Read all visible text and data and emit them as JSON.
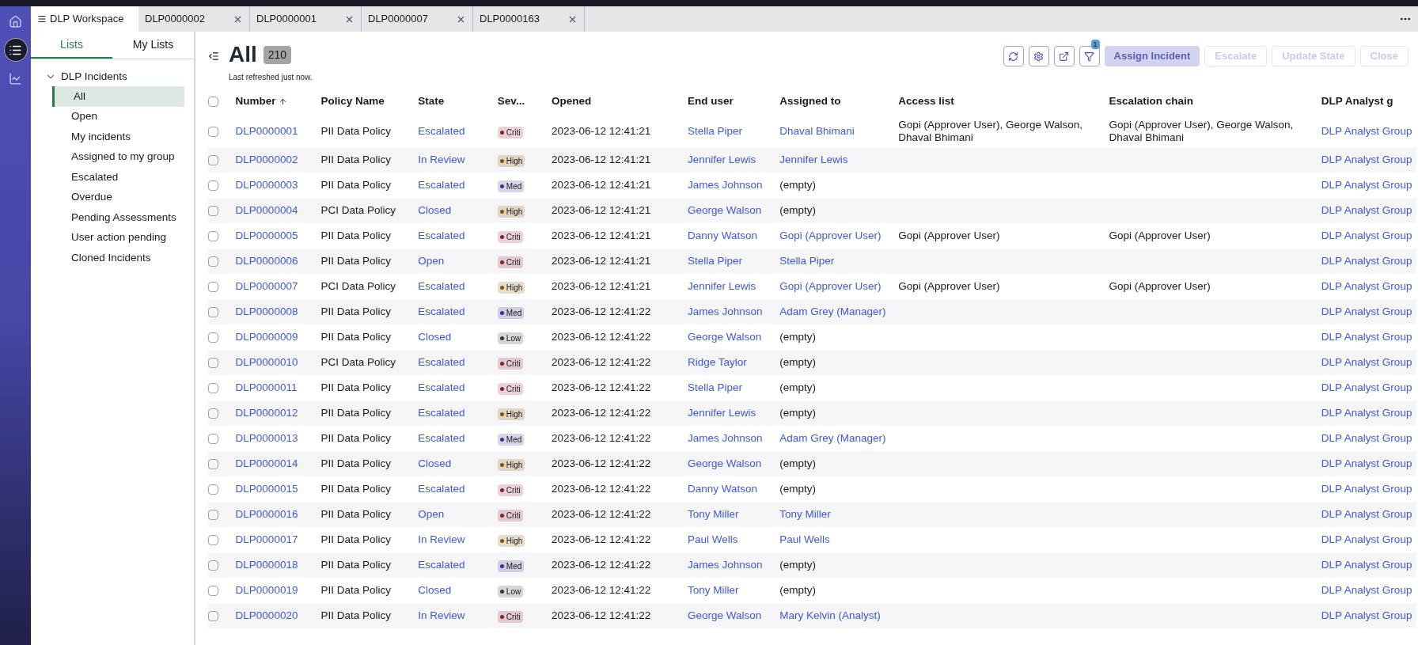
{
  "rail": [
    {
      "kind": "home",
      "selected": false
    },
    {
      "kind": "list",
      "selected": true
    },
    {
      "kind": "analytics",
      "selected": false
    }
  ],
  "tabs": [
    {
      "label": "DLP Workspace",
      "selected": true,
      "closable": false
    },
    {
      "label": "DLP0000002",
      "selected": false,
      "closable": true
    },
    {
      "label": "DLP0000001",
      "selected": false,
      "closable": true
    },
    {
      "label": "DLP0000007",
      "selected": false,
      "closable": true
    },
    {
      "label": "DLP0000163",
      "selected": false,
      "closable": true
    }
  ],
  "sidebar": {
    "tabs": [
      {
        "label": "Lists",
        "selected": true
      },
      {
        "label": "My Lists",
        "selected": false
      }
    ],
    "group": {
      "label": "DLP Incidents",
      "expanded": true,
      "children": [
        {
          "label": "All",
          "selected": true
        },
        {
          "label": "Open",
          "selected": false
        },
        {
          "label": "My incidents",
          "selected": false
        },
        {
          "label": "Assigned to my group",
          "selected": false
        },
        {
          "label": "Escalated",
          "selected": false
        },
        {
          "label": "Overdue",
          "selected": false
        },
        {
          "label": "Pending Assessments",
          "selected": false
        },
        {
          "label": "User action pending",
          "selected": false
        },
        {
          "label": "Cloned Incidents",
          "selected": false
        }
      ]
    }
  },
  "list": {
    "title": "All",
    "count": "210",
    "refreshed": "Last refreshed just now.",
    "filter_count": "1",
    "actions": [
      {
        "label": "Assign Incident",
        "kind": "primary",
        "disabled": true
      },
      {
        "label": "Escalate",
        "kind": "secondary",
        "disabled": true
      },
      {
        "label": "Update State",
        "kind": "secondary",
        "disabled": true
      },
      {
        "label": "Close",
        "kind": "secondary",
        "disabled": true
      }
    ]
  },
  "table": {
    "select_all_checked": false,
    "columns": [
      {
        "label": "Number",
        "sorted": true
      },
      {
        "label": "Policy Name",
        "sorted": false
      },
      {
        "label": "State",
        "sorted": false
      },
      {
        "label": "Sev...",
        "sorted": false
      },
      {
        "label": "Opened",
        "sorted": false
      },
      {
        "label": "End user",
        "sorted": false
      },
      {
        "label": "Assigned to",
        "sorted": false
      },
      {
        "label": "Access list",
        "sorted": false
      },
      {
        "label": "Escalation chain",
        "sorted": false
      },
      {
        "label": "DLP Analyst g",
        "sorted": false
      }
    ],
    "rows": [
      {
        "checked": false,
        "number": "DLP0000001",
        "policy": "PII Data Policy",
        "state": "Escalated",
        "severity": {
          "label": "Criti",
          "color": "#8b1e2b"
        },
        "opened": "2023-06-12 12:41:21",
        "end_user": "Stella Piper",
        "assigned_to": {
          "text": "Dhaval Bhimani",
          "kind": "link"
        },
        "access_list": "Gopi  (Approver User), George Walson, Dhaval Bhimani",
        "escalation_chain": "Gopi  (Approver User), George Walson, Dhaval Bhimani",
        "group": "DLP Analyst Group"
      },
      {
        "checked": false,
        "number": "DLP0000002",
        "policy": "PII Data Policy",
        "state": "In Review",
        "severity": {
          "label": "High",
          "color": "#8a5300"
        },
        "opened": "2023-06-12 12:41:21",
        "end_user": "Jennifer Lewis",
        "assigned_to": {
          "text": "Jennifer Lewis",
          "kind": "link"
        },
        "group": "DLP Analyst Group"
      },
      {
        "checked": false,
        "number": "DLP0000003",
        "policy": "PII Data Policy",
        "state": "Escalated",
        "severity": {
          "label": "Med",
          "color": "#3b2e8c"
        },
        "opened": "2023-06-12 12:41:21",
        "end_user": "James Johnson",
        "assigned_to": {
          "text": "(empty)",
          "kind": "plain"
        },
        "group": "DLP Analyst Group"
      },
      {
        "checked": false,
        "number": "DLP0000004",
        "policy": "PCI Data Policy",
        "state": "Closed",
        "severity": {
          "label": "High",
          "color": "#8a5300"
        },
        "opened": "2023-06-12 12:41:21",
        "end_user": "George Walson",
        "assigned_to": {
          "text": "(empty)",
          "kind": "plain"
        },
        "group": "DLP Analyst Group"
      },
      {
        "checked": false,
        "number": "DLP0000005",
        "policy": "PII Data Policy",
        "state": "Escalated",
        "severity": {
          "label": "Criti",
          "color": "#8b1e2b"
        },
        "opened": "2023-06-12 12:41:21",
        "end_user": "Danny Watson",
        "assigned_to": {
          "text": "Gopi  (Approver User)",
          "kind": "link"
        },
        "access_list": "Gopi  (Approver User)",
        "escalation_chain": "Gopi  (Approver User)",
        "group": "DLP Analyst Group"
      },
      {
        "checked": false,
        "number": "DLP0000006",
        "policy": "PII Data Policy",
        "state": "Open",
        "severity": {
          "label": "Criti",
          "color": "#8b1e2b"
        },
        "opened": "2023-06-12 12:41:21",
        "end_user": "Stella Piper",
        "assigned_to": {
          "text": "Stella Piper",
          "kind": "link"
        },
        "group": "DLP Analyst Group"
      },
      {
        "checked": false,
        "number": "DLP0000007",
        "policy": "PCI Data Policy",
        "state": "Escalated",
        "severity": {
          "label": "High",
          "color": "#8a5300"
        },
        "opened": "2023-06-12 12:41:21",
        "end_user": "Jennifer Lewis",
        "assigned_to": {
          "text": "Gopi  (Approver User)",
          "kind": "link"
        },
        "access_list": "Gopi  (Approver User)",
        "escalation_chain": "Gopi  (Approver User)",
        "group": "DLP Analyst Group"
      },
      {
        "checked": false,
        "number": "DLP0000008",
        "policy": "PII Data Policy",
        "state": "Escalated",
        "severity": {
          "label": "Med",
          "color": "#3b2e8c"
        },
        "opened": "2023-06-12 12:41:22",
        "end_user": "James Johnson",
        "assigned_to": {
          "text": "Adam Grey (Manager)",
          "kind": "link"
        },
        "group": "DLP Analyst Group"
      },
      {
        "checked": false,
        "number": "DLP0000009",
        "policy": "PII Data Policy",
        "state": "Closed",
        "severity": {
          "label": "Low",
          "color": "#333333"
        },
        "opened": "2023-06-12 12:41:22",
        "end_user": "George Walson",
        "assigned_to": {
          "text": "(empty)",
          "kind": "plain"
        },
        "group": "DLP Analyst Group"
      },
      {
        "checked": false,
        "number": "DLP0000010",
        "policy": "PCI Data Policy",
        "state": "Escalated",
        "severity": {
          "label": "Criti",
          "color": "#8b1e2b"
        },
        "opened": "2023-06-12 12:41:22",
        "end_user": "Ridge Taylor",
        "assigned_to": {
          "text": "(empty)",
          "kind": "plain"
        },
        "group": "DLP Analyst Group"
      },
      {
        "checked": false,
        "number": "DLP0000011",
        "policy": "PII Data Policy",
        "state": "Escalated",
        "severity": {
          "label": "Criti",
          "color": "#8b1e2b"
        },
        "opened": "2023-06-12 12:41:22",
        "end_user": "Stella Piper",
        "assigned_to": {
          "text": "(empty)",
          "kind": "plain"
        },
        "group": "DLP Analyst Group"
      },
      {
        "checked": false,
        "number": "DLP0000012",
        "policy": "PII Data Policy",
        "state": "Escalated",
        "severity": {
          "label": "High",
          "color": "#8a5300"
        },
        "opened": "2023-06-12 12:41:22",
        "end_user": "Jennifer Lewis",
        "assigned_to": {
          "text": "(empty)",
          "kind": "plain"
        },
        "group": "DLP Analyst Group"
      },
      {
        "checked": false,
        "number": "DLP0000013",
        "policy": "PII Data Policy",
        "state": "Escalated",
        "severity": {
          "label": "Med",
          "color": "#3b2e8c"
        },
        "opened": "2023-06-12 12:41:22",
        "end_user": "James Johnson",
        "assigned_to": {
          "text": "Adam Grey (Manager)",
          "kind": "link"
        },
        "group": "DLP Analyst Group"
      },
      {
        "checked": false,
        "number": "DLP0000014",
        "policy": "PII Data Policy",
        "state": "Closed",
        "severity": {
          "label": "High",
          "color": "#8a5300"
        },
        "opened": "2023-06-12 12:41:22",
        "end_user": "George Walson",
        "assigned_to": {
          "text": "(empty)",
          "kind": "plain"
        },
        "group": "DLP Analyst Group"
      },
      {
        "checked": false,
        "number": "DLP0000015",
        "policy": "PII Data Policy",
        "state": "Escalated",
        "severity": {
          "label": "Criti",
          "color": "#8b1e2b"
        },
        "opened": "2023-06-12 12:41:22",
        "end_user": "Danny Watson",
        "assigned_to": {
          "text": "(empty)",
          "kind": "plain"
        },
        "group": "DLP Analyst Group"
      },
      {
        "checked": false,
        "number": "DLP0000016",
        "policy": "PII Data Policy",
        "state": "Open",
        "severity": {
          "label": "Criti",
          "color": "#8b1e2b"
        },
        "opened": "2023-06-12 12:41:22",
        "end_user": "Tony Miller",
        "assigned_to": {
          "text": "Tony Miller",
          "kind": "link"
        },
        "group": "DLP Analyst Group"
      },
      {
        "checked": false,
        "number": "DLP0000017",
        "policy": "PII Data Policy",
        "state": "In Review",
        "severity": {
          "label": "High",
          "color": "#8a5300"
        },
        "opened": "2023-06-12 12:41:22",
        "end_user": "Paul Wells",
        "assigned_to": {
          "text": "Paul Wells",
          "kind": "link"
        },
        "group": "DLP Analyst Group"
      },
      {
        "checked": false,
        "number": "DLP0000018",
        "policy": "PII Data Policy",
        "state": "Escalated",
        "severity": {
          "label": "Med",
          "color": "#3b2e8c"
        },
        "opened": "2023-06-12 12:41:22",
        "end_user": "James Johnson",
        "assigned_to": {
          "text": "(empty)",
          "kind": "plain"
        },
        "group": "DLP Analyst Group"
      },
      {
        "checked": false,
        "number": "DLP0000019",
        "policy": "PII Data Policy",
        "state": "Closed",
        "severity": {
          "label": "Low",
          "color": "#333333"
        },
        "opened": "2023-06-12 12:41:22",
        "end_user": "Tony Miller",
        "assigned_to": {
          "text": "(empty)",
          "kind": "plain"
        },
        "group": "DLP Analyst Group"
      },
      {
        "checked": false,
        "number": "DLP0000020",
        "policy": "PII Data Policy",
        "state": "In Review",
        "severity": {
          "label": "Criti",
          "color": "#8b1e2b"
        },
        "opened": "2023-06-12 12:41:22",
        "end_user": "George Walson",
        "assigned_to": {
          "text": "Mary Kelvin (Analyst)",
          "kind": "link"
        },
        "group": "DLP Analyst Group"
      }
    ]
  }
}
